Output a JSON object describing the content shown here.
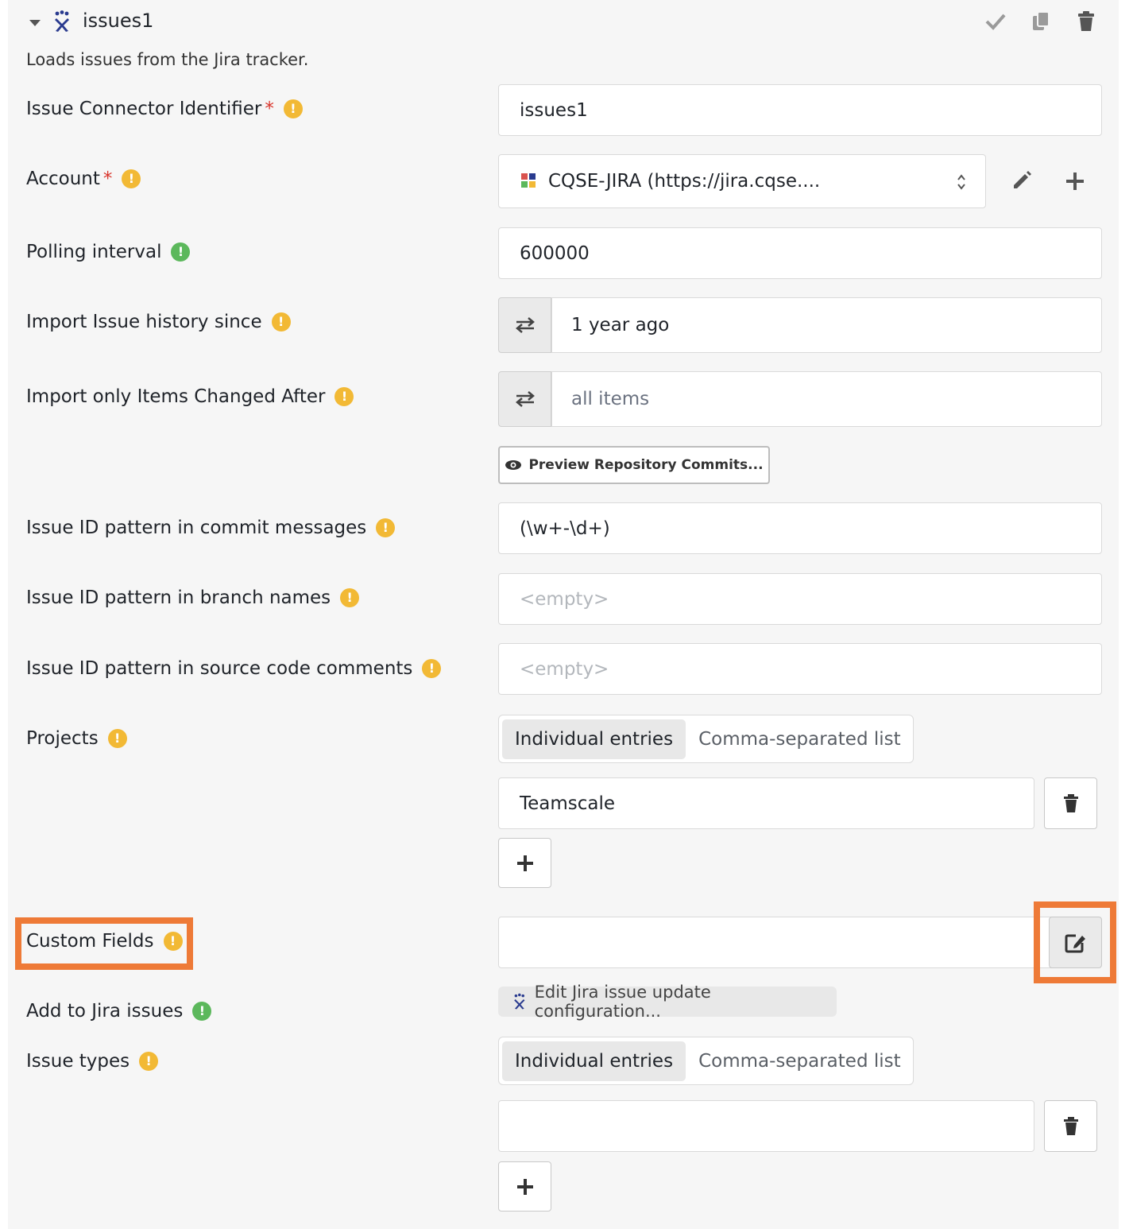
{
  "header": {
    "title": "issues1",
    "description": "Loads issues from the Jira tracker.",
    "icons": {
      "collapse": "caret-down-icon",
      "connector": "jira-icon",
      "confirm": "check-icon",
      "copy": "copy-icon",
      "delete": "trash-icon"
    }
  },
  "fields": {
    "identifier": {
      "label": "Issue Connector Identifier",
      "required": "*",
      "value": "issues1"
    },
    "account": {
      "label": "Account",
      "required": "*",
      "value": "CQSE-JIRA (https://jira.cqse...."
    },
    "polling": {
      "label": "Polling interval",
      "value": "600000"
    },
    "history": {
      "label": "Import Issue history since",
      "value": "1 year ago"
    },
    "changed_after": {
      "label": "Import only Items Changed After",
      "placeholder": "all items"
    },
    "preview_button": "Preview Repository Commits...",
    "commit_pattern": {
      "label": "Issue ID pattern in commit messages",
      "value": "(\\w+-\\d+)"
    },
    "branch_pattern": {
      "label": "Issue ID pattern in branch names",
      "placeholder": "<empty>"
    },
    "comment_pattern": {
      "label": "Issue ID pattern in source code comments",
      "placeholder": "<empty>"
    },
    "projects": {
      "label": "Projects",
      "toggle": [
        "Individual entries",
        "Comma-separated list"
      ],
      "entries": [
        "Teamscale"
      ]
    },
    "custom_fields": {
      "label": "Custom Fields",
      "value": ""
    },
    "add_to_jira": {
      "label": "Add to Jira issues",
      "button": "Edit Jira issue update configuration..."
    },
    "issue_types": {
      "label": "Issue types",
      "toggle": [
        "Individual entries",
        "Comma-separated list"
      ],
      "entries": [
        ""
      ]
    }
  },
  "hint_icon": "!",
  "colors": {
    "warning": "#f2b935",
    "success": "#5cb85c",
    "required": "#d9342b",
    "highlight": "#ee7a37"
  }
}
